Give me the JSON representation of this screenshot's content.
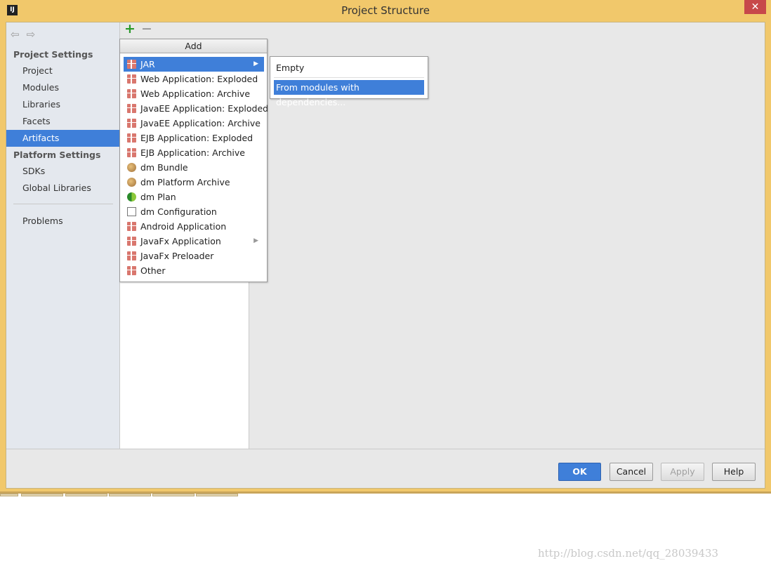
{
  "window": {
    "title": "Project Structure",
    "app_icon": "IJ",
    "close": "✕"
  },
  "nav": {
    "back": "⇦",
    "forward": "⇨"
  },
  "sidebar": {
    "project_settings": "Project Settings",
    "project_items": [
      {
        "label": "Project"
      },
      {
        "label": "Modules"
      },
      {
        "label": "Libraries"
      },
      {
        "label": "Facets"
      },
      {
        "label": "Artifacts",
        "selected": true
      }
    ],
    "platform_settings": "Platform Settings",
    "platform_items": [
      {
        "label": "SDKs"
      },
      {
        "label": "Global Libraries"
      }
    ],
    "problems": "Problems"
  },
  "toolbar": {
    "add": "+",
    "remove": "−"
  },
  "add_menu": {
    "title": "Add",
    "items": [
      {
        "label": "JAR",
        "icon": "gift",
        "submenu": true,
        "selected": true
      },
      {
        "label": "Web Application: Exploded",
        "icon": "gift"
      },
      {
        "label": "Web Application: Archive",
        "icon": "gift"
      },
      {
        "label": "JavaEE Application: Exploded",
        "icon": "gift"
      },
      {
        "label": "JavaEE Application: Archive",
        "icon": "gift"
      },
      {
        "label": "EJB Application: Exploded",
        "icon": "gift"
      },
      {
        "label": "EJB Application: Archive",
        "icon": "gift"
      },
      {
        "label": "dm Bundle",
        "icon": "osgi"
      },
      {
        "label": "dm Platform Archive",
        "icon": "osgi"
      },
      {
        "label": "dm Plan",
        "icon": "plan"
      },
      {
        "label": "dm Configuration",
        "icon": "doc"
      },
      {
        "label": "Android Application",
        "icon": "gift"
      },
      {
        "label": "JavaFx Application",
        "icon": "gift",
        "submenu": true
      },
      {
        "label": "JavaFx Preloader",
        "icon": "gift"
      },
      {
        "label": "Other",
        "icon": "gift"
      }
    ]
  },
  "jar_submenu": {
    "items": [
      {
        "label": "Empty"
      },
      {
        "label": "From modules with dependencies...",
        "selected": true
      }
    ]
  },
  "buttons": {
    "ok": "OK",
    "cancel": "Cancel",
    "apply": "Apply",
    "help": "Help"
  },
  "watermark": "http://blog.csdn.net/qq_28039433",
  "colors": {
    "accent": "#3f7fd9",
    "titlebar": "#f1c86b"
  }
}
